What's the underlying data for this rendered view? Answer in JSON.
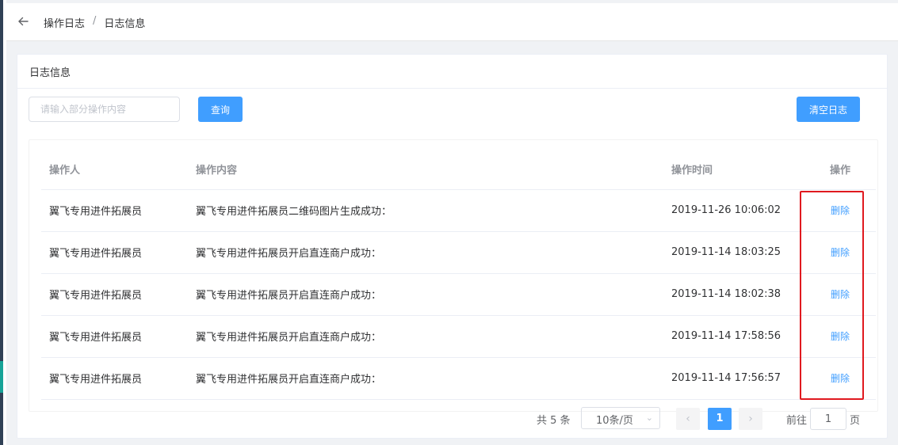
{
  "breadcrumb": [
    "操作日志",
    "日志信息"
  ],
  "card_title": "日志信息",
  "search": {
    "placeholder": "请输入部分操作内容",
    "value": ""
  },
  "buttons": {
    "query": "查询",
    "clear": "清空日志"
  },
  "table": {
    "columns": [
      "操作人",
      "操作内容",
      "操作时间",
      "操作"
    ],
    "rows": [
      {
        "operator": "翼飞专用进件拓展员",
        "content": "翼飞专用进件拓展员二维码图片生成成功：",
        "time": "2019-11-26 10:06:02",
        "action": "删除"
      },
      {
        "operator": "翼飞专用进件拓展员",
        "content": "翼飞专用进件拓展员开启直连商户成功：",
        "time": "2019-11-14 18:03:25",
        "action": "删除"
      },
      {
        "operator": "翼飞专用进件拓展员",
        "content": "翼飞专用进件拓展员开启直连商户成功：",
        "time": "2019-11-14 18:02:38",
        "action": "删除"
      },
      {
        "operator": "翼飞专用进件拓展员",
        "content": "翼飞专用进件拓展员开启直连商户成功：",
        "time": "2019-11-14 17:58:56",
        "action": "删除"
      },
      {
        "operator": "翼飞专用进件拓展员",
        "content": "翼飞专用进件拓展员开启直连商户成功：",
        "time": "2019-11-14 17:56:57",
        "action": "删除"
      }
    ]
  },
  "pagination": {
    "total": "共 5 条",
    "page_size": "10条/页",
    "current_page": "1",
    "goto_label": "前往",
    "goto_value": "1",
    "page_unit": "页"
  },
  "icons": {
    "back": "arrow-left-icon",
    "prev": "chevron-left-icon",
    "next": "chevron-right-icon",
    "dropdown": "chevron-down-icon"
  },
  "colors": {
    "primary": "#409eff",
    "highlight": "#e0191f",
    "sidebar": "#304156",
    "sidebar_active": "#17a398"
  }
}
